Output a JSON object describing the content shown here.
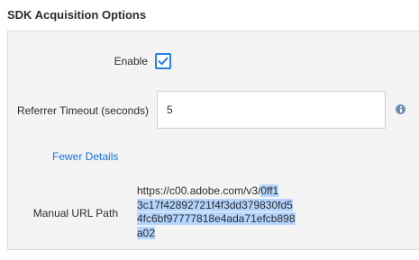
{
  "section": {
    "title": "SDK Acquisition Options"
  },
  "enable": {
    "label": "Enable",
    "checked": true
  },
  "referrer_timeout": {
    "label": "Referrer Timeout (seconds)",
    "value": "5"
  },
  "info_icon": "info-icon",
  "fewer_details": {
    "label": "Fewer Details"
  },
  "manual_url": {
    "label": "Manual URL Path",
    "line1_plain": "https://c00.adobe.com/v3/",
    "line1_selected": "0ff1",
    "line2": "3c17f42892721f4f3dd379830fd5",
    "line3": "4fc6bf97777818e4ada71efcb898",
    "line4": "a02"
  },
  "colors": {
    "accent": "#2680eb",
    "link": "#1473e6",
    "selection": "#b4d5fe",
    "panel_bg": "#f4f4f4"
  }
}
